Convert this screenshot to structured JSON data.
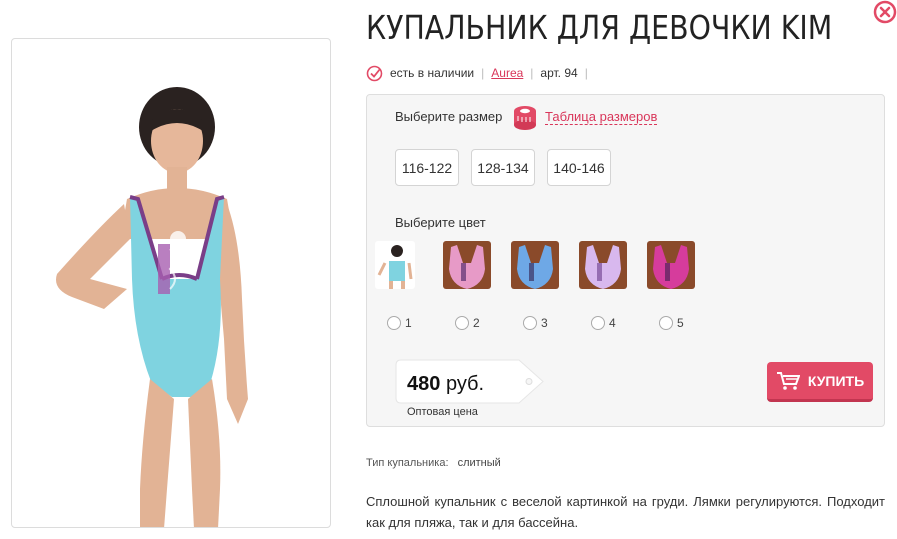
{
  "product": {
    "title": "КУПАЛЬНИК ДЛЯ ДЕВОЧКИ KIM",
    "availability": "есть в наличии",
    "brand": "Aurea",
    "article": "арт. 94"
  },
  "image_caption_fragment": "",
  "options": {
    "size_label": "Выберите размер",
    "size_table_link": "Таблица размеров",
    "sizes": [
      "116-122",
      "128-134",
      "140-146"
    ],
    "color_label": "Выберите цвет",
    "colors": [
      {
        "num": "1",
        "swatch": "#7fd3e0"
      },
      {
        "num": "2",
        "swatch": "#e79ac7"
      },
      {
        "num": "3",
        "swatch": "#6ea8e6"
      },
      {
        "num": "4",
        "swatch": "#d8b8ee"
      },
      {
        "num": "5",
        "swatch": "#d63c9c"
      }
    ]
  },
  "price": {
    "amount": "480",
    "currency": "руб.",
    "note": "Оптовая цена"
  },
  "buy_label": "КУПИТЬ",
  "attributes": {
    "type_label": "Тип купальника:",
    "type_value": "слитный"
  },
  "description": "Сплошной купальник с веселой картинкой на груди. Лямки регулируются. Подходит как для пляжа, так и для бассейна.",
  "colors": {
    "accent": "#e24a66",
    "link": "#d9365a"
  }
}
